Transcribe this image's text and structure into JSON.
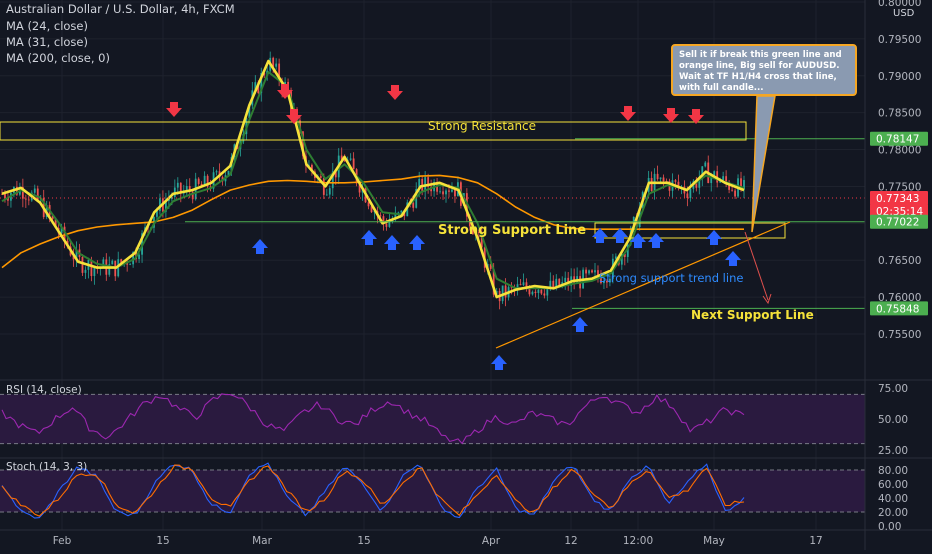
{
  "header": {
    "title": "Australian Dollar / U.S. Dollar, 4h, FXCM",
    "indicators": [
      "MA (24, close)",
      "MA (31, close)",
      "MA (200, close, 0)"
    ],
    "currency": "USD"
  },
  "chart_data": [
    {
      "type": "line",
      "chart": "price",
      "title": "Australian Dollar / U.S. Dollar, 4h, FXCM",
      "ylim": [
        0.75,
        0.8
      ],
      "y_ticks": [
        0.755,
        0.76,
        0.765,
        0.77,
        0.775,
        0.78,
        0.785,
        0.79,
        0.795,
        0.8
      ],
      "x_tick_labels": [
        "Feb",
        "15",
        "Mar",
        "15",
        "Apr",
        "12",
        "12:00",
        "May",
        "17"
      ],
      "series": [
        {
          "name": "MA (24, close)",
          "color": "#f5e23a",
          "values": [
            0.774,
            0.7748,
            0.7728,
            0.7688,
            0.7648,
            0.764,
            0.764,
            0.766,
            0.7715,
            0.774,
            0.7745,
            0.7755,
            0.7778,
            0.786,
            0.792,
            0.788,
            0.778,
            0.775,
            0.779,
            0.7745,
            0.77,
            0.771,
            0.775,
            0.7755,
            0.7745,
            0.768,
            0.76,
            0.761,
            0.7615,
            0.7612,
            0.7622,
            0.7625,
            0.7636,
            0.768,
            0.7755,
            0.7755,
            0.7745,
            0.777,
            0.7755,
            0.7745
          ]
        },
        {
          "name": "MA (31, close)",
          "color": "#2e7d32",
          "values": [
            0.773,
            0.7745,
            0.7735,
            0.77,
            0.766,
            0.7645,
            0.764,
            0.7652,
            0.77,
            0.773,
            0.774,
            0.7748,
            0.7766,
            0.784,
            0.7905,
            0.7885,
            0.78,
            0.776,
            0.778,
            0.7755,
            0.7715,
            0.7712,
            0.7742,
            0.7752,
            0.7748,
            0.77,
            0.7625,
            0.7612,
            0.7612,
            0.7612,
            0.7618,
            0.7622,
            0.7632,
            0.767,
            0.774,
            0.7752,
            0.7746,
            0.7765,
            0.7756,
            0.7748
          ]
        },
        {
          "name": "MA (200, close, 0)",
          "color": "#ff9800",
          "values": [
            0.764,
            0.766,
            0.7672,
            0.7682,
            0.769,
            0.7695,
            0.7698,
            0.77,
            0.7702,
            0.7708,
            0.7718,
            0.7732,
            0.7745,
            0.7752,
            0.7757,
            0.7758,
            0.7757,
            0.7755,
            0.7755,
            0.7756,
            0.7758,
            0.776,
            0.7764,
            0.7765,
            0.7762,
            0.7755,
            0.774,
            0.7722,
            0.7708,
            0.7698,
            0.7693,
            0.7692,
            0.7692,
            0.7692,
            0.7692,
            0.7692,
            0.7692,
            0.7692,
            0.7692,
            0.7692
          ]
        }
      ],
      "price_labels": [
        {
          "value": "0.78147",
          "color": "#4caf50"
        },
        {
          "value": "0.77343",
          "color": "#f23645"
        },
        {
          "value": "02:35:14",
          "color": "#f23645"
        },
        {
          "value": "0.77022",
          "color": "#4caf50"
        },
        {
          "value": "0.75848",
          "color": "#4caf50"
        }
      ],
      "annotations": {
        "resistance_label": "Strong Resistance",
        "support_label": "Strong Support Line",
        "trend_label": "Strong support trend line",
        "next_support_label": "Next Support Line",
        "callout": "Sell it if break this green line and orange line, Big sell for AUDUSD. Wait at TF H1/H4 cross that line, with full candle..."
      }
    },
    {
      "type": "line",
      "chart": "rsi",
      "title": "RSI (14, close)",
      "ylim": [
        20,
        80
      ],
      "y_ticks": [
        25.0,
        50.0,
        75.0
      ],
      "series": [
        {
          "name": "RSI",
          "color": "#9c27b0",
          "values": [
            55,
            45,
            38,
            50,
            60,
            42,
            35,
            48,
            62,
            70,
            58,
            52,
            66,
            72,
            60,
            45,
            40,
            55,
            62,
            50,
            45,
            58,
            65,
            55,
            48,
            35,
            30,
            42,
            52,
            45,
            55,
            50,
            45,
            60,
            70,
            62,
            55,
            68,
            60,
            40,
            48,
            58,
            52
          ]
        }
      ]
    },
    {
      "type": "line",
      "chart": "stoch",
      "title": "Stoch (14, 3, 3)",
      "ylim": [
        0,
        100
      ],
      "y_ticks": [
        0.0,
        20.0,
        40.0,
        60.0,
        80.0
      ],
      "series": [
        {
          "name": "%K",
          "color": "#2962ff",
          "values": [
            60,
            20,
            10,
            50,
            85,
            70,
            20,
            15,
            60,
            90,
            80,
            30,
            20,
            75,
            90,
            40,
            15,
            50,
            85,
            60,
            20,
            70,
            90,
            30,
            10,
            55,
            80,
            25,
            15,
            65,
            88,
            40,
            20,
            70,
            85,
            30,
            60,
            90,
            20,
            40
          ]
        },
        {
          "name": "%D",
          "color": "#ff6d00",
          "values": [
            55,
            30,
            15,
            40,
            75,
            75,
            30,
            18,
            50,
            85,
            82,
            40,
            25,
            65,
            88,
            50,
            20,
            40,
            80,
            65,
            28,
            60,
            85,
            40,
            15,
            45,
            75,
            35,
            18,
            55,
            82,
            50,
            25,
            60,
            82,
            40,
            50,
            85,
            30,
            35
          ]
        }
      ]
    }
  ]
}
